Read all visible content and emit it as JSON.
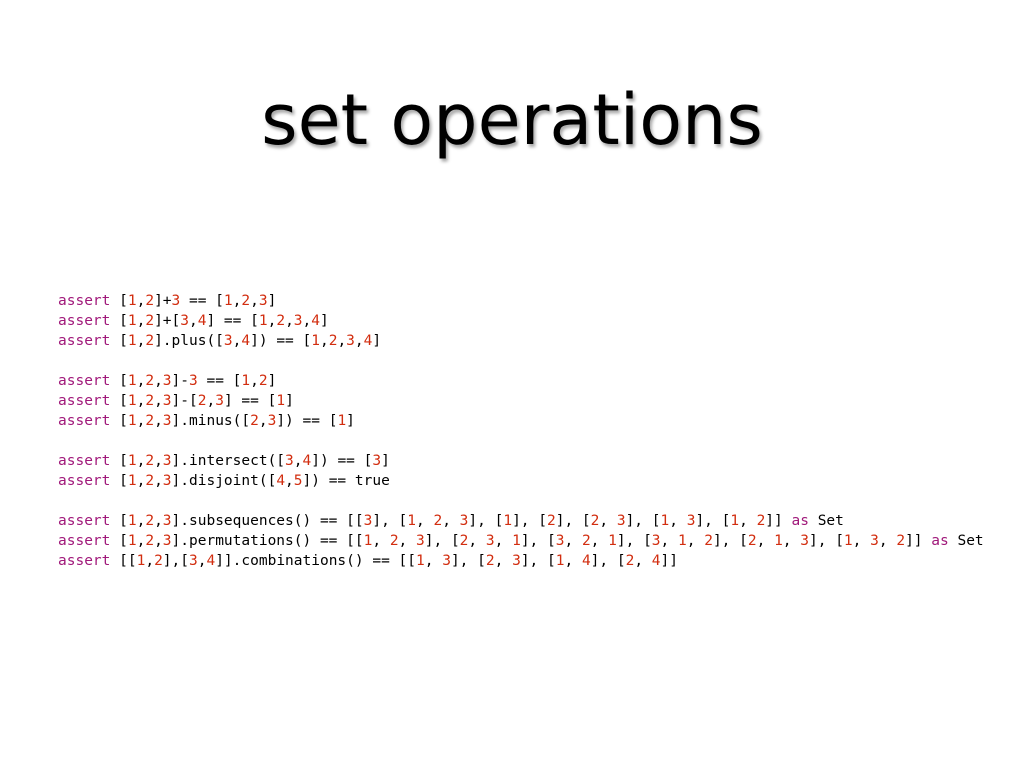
{
  "title": "set operations",
  "colors": {
    "keyword": "#a0187a",
    "number": "#d22d0f",
    "text": "#000000",
    "background": "#ffffff"
  },
  "code": [
    {
      "name": "code-line-list-plus-element",
      "text": "assert [1,2]+3 == [1,2,3]"
    },
    {
      "name": "code-line-list-plus-list",
      "text": "assert [1,2]+[3,4] == [1,2,3,4]"
    },
    {
      "name": "code-line-list-plus-method",
      "text": "assert [1,2].plus([3,4]) == [1,2,3,4]"
    },
    null,
    {
      "name": "code-line-list-minus-element",
      "text": "assert [1,2,3]-3 == [1,2]"
    },
    {
      "name": "code-line-list-minus-list",
      "text": "assert [1,2,3]-[2,3] == [1]"
    },
    {
      "name": "code-line-list-minus-method",
      "text": "assert [1,2,3].minus([2,3]) == [1]"
    },
    null,
    {
      "name": "code-line-intersect",
      "text": "assert [1,2,3].intersect([3,4]) == [3]"
    },
    {
      "name": "code-line-disjoint",
      "text": "assert [1,2,3].disjoint([4,5]) == true"
    },
    null,
    {
      "name": "code-line-subsequences",
      "text": "assert [1,2,3].subsequences() == [[3], [1, 2, 3], [1], [2], [2, 3], [1, 3], [1, 2]] as Set"
    },
    {
      "name": "code-line-permutations",
      "text": "assert [1,2,3].permutations() == [[1, 2, 3], [2, 3, 1], [3, 2, 1], [3, 1, 2], [2, 1, 3], [1, 3, 2]] as Set"
    },
    {
      "name": "code-line-combinations",
      "text": "assert [[1,2],[3,4]].combinations() == [[1, 3], [2, 3], [1, 4], [2, 4]]"
    }
  ]
}
